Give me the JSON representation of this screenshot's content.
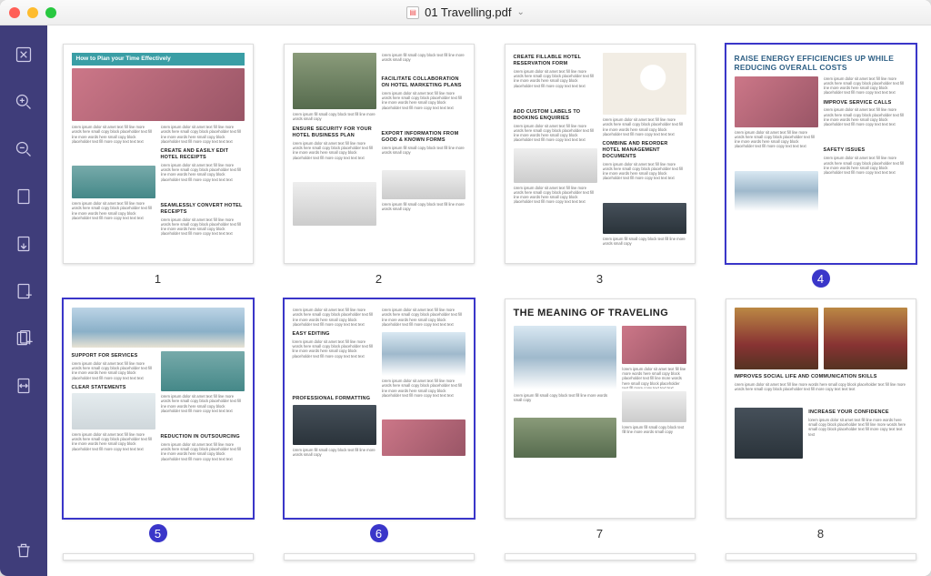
{
  "window": {
    "filename": "01 Travelling.pdf"
  },
  "sidebar_tools": [
    {
      "name": "close-panel",
      "icon": "x"
    },
    {
      "name": "zoom-in",
      "icon": "plus-magnify"
    },
    {
      "name": "zoom-out",
      "icon": "minus-magnify"
    },
    {
      "name": "blank-page",
      "icon": "page"
    },
    {
      "name": "extract-page",
      "icon": "page-out"
    },
    {
      "name": "insert-page",
      "icon": "page-plus"
    },
    {
      "name": "insert-file",
      "icon": "file-plus"
    },
    {
      "name": "replace-page",
      "icon": "swap"
    },
    {
      "name": "delete-page",
      "icon": "trash"
    }
  ],
  "pages": [
    {
      "n": 1,
      "selected": false,
      "headline": "How to Plan your Time Effectively"
    },
    {
      "n": 2,
      "selected": false,
      "headline": ""
    },
    {
      "n": 3,
      "selected": false,
      "headline": ""
    },
    {
      "n": 4,
      "selected": true,
      "headline": "Raise Energy Efficiencies Up While Reducing Overall Costs"
    },
    {
      "n": 5,
      "selected": true,
      "headline": ""
    },
    {
      "n": 6,
      "selected": true,
      "headline": ""
    },
    {
      "n": 7,
      "selected": false,
      "headline": "THE MEANING OF TRAVELING"
    },
    {
      "n": 8,
      "selected": false,
      "headline": ""
    }
  ],
  "page_text": {
    "p1": {
      "band": "How to Plan your Time Effectively",
      "h1": "CREATE AND EASILY EDIT HOTEL RECEIPTS",
      "h2": "SEAMLESSLY CONVERT HOTEL RECEIPTS"
    },
    "p2": {
      "h1": "FACILITATE COLLABORATION ON HOTEL MARKETING PLANS",
      "h2": "ENSURE SECURITY FOR YOUR HOTEL BUSINESS PLAN",
      "h3": "EXPORT INFORMATION FROM GOOD & KNOWN FORMS"
    },
    "p3": {
      "h1": "CREATE FILLABLE HOTEL RESERVATION FORM",
      "h2": "COMBINE AND REORDER HOTEL MANAGEMENT DOCUMENTS",
      "h3": "ADD CUSTOM LABELS TO BOOKING ENQUIRIES"
    },
    "p4": {
      "title": "Raise Energy Efficiencies Up While Reducing Overall Costs",
      "h1": "IMPROVE SERVICE CALLS",
      "h2": "SAFETY ISSUES"
    },
    "p5": {
      "h1": "SUPPORT FOR SERVICES",
      "h2": "CLEAR STATEMENTS",
      "h3": "REDUCTION IN OUTSOURCING"
    },
    "p6": {
      "h1": "EASY EDITING",
      "h2": "PROFESSIONAL FORMATTING"
    },
    "p7": {
      "title": "THE MEANING OF TRAVELING"
    },
    "p8": {
      "h1": "IMPROVES SOCIAL LIFE AND COMMUNICATION SKILLS",
      "h2": "INCREASE YOUR CONFIDENCE"
    }
  }
}
